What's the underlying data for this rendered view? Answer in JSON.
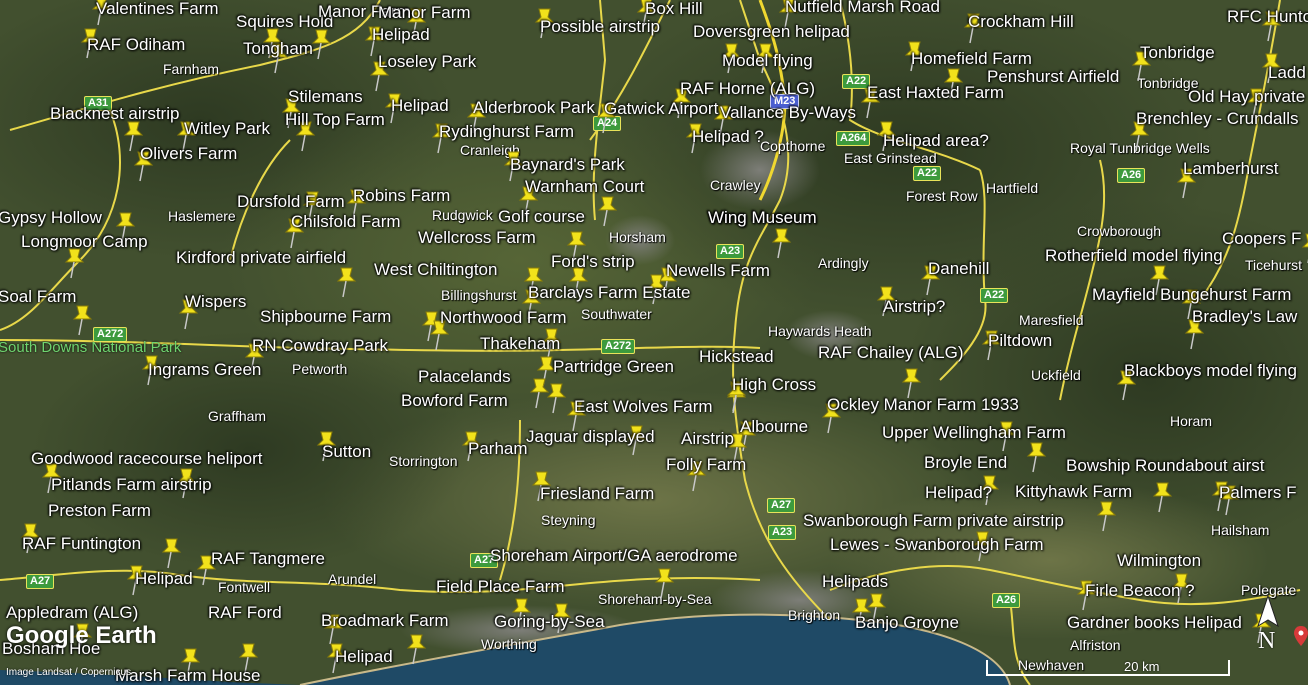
{
  "map": {
    "logo": "Google Earth",
    "attribution": "Image Landsat / Copernicus",
    "scale_label": "20 km",
    "compass_letter": "N",
    "park_label": "South Downs National Park",
    "placemarks": [
      "Valentines Farm",
      "Squires Hold",
      "Manor Farm",
      "Box Hill",
      "Nutfield Marsh Road",
      "Crockham Hill",
      "RFC Hunto",
      "RAF Odiham",
      "Tongham",
      "Helipad",
      "Possible airstrip",
      "Doversgreen helipad",
      "Model flying",
      "Homefield Farm",
      "Tonbridge",
      "Loseley Park",
      "RAF Horne (ALG)",
      "Penshurst Airfield",
      "Ladd",
      "Stilemans",
      "Helipad",
      "Alderbrook Park",
      "Gatwick Airport",
      "Vallance By-Ways",
      "East Haxted Farm",
      "Old Hay private",
      "Blacknest airstrip",
      "Witley Park",
      "Hill Top Farm",
      "Rydinghurst Farm",
      "Helipad ?",
      "Helipad area?",
      "Brenchley - Crundalls",
      "Olivers Farm",
      "Baynard's Park",
      "Lamberhurst",
      "Warnham Court",
      "Dursfold Farm",
      "Robins Farm",
      "Gypsy Hollow",
      "Golf course",
      "Chilsfold Farm",
      "Wing Museum",
      "Longmoor Camp",
      "Wellcross Farm",
      "Coopers F",
      "Kirdford private airfield",
      "Ford's strip",
      "Rotherfield model flying",
      "West Chiltington",
      "Newells Farm",
      "Danehill",
      "Soal Farm",
      "Barclays Farm Estate",
      "Mayfield Bungehurst Farm",
      "Wispers",
      "Airstrip?",
      "Shipbourne Farm",
      "Northwood Farm",
      "Bradley's Law",
      "RN Cowdray Park",
      "Thakeham",
      "Hickstead",
      "RAF Chailey (ALG)",
      "Piltdown",
      "Ingrams Green",
      "Partridge Green",
      "Blackboys model flying",
      "Palacelands",
      "High Cross",
      "Bowford Farm",
      "East Wolves Farm",
      "Ockley Manor Farm 1933",
      "Albourne",
      "Upper Wellingham Farm",
      "Sutton",
      "Jaguar displayed",
      "Airstrip",
      "Parham",
      "Broyle End",
      "Bowship Roundabout airst",
      "Goodwood racecourse heliport",
      "Folly Farm",
      "Pitlands Farm airstrip",
      "Helipad?",
      "Kittyhawk Farm",
      "Palmers F",
      "Friesland Farm",
      "Preston Farm",
      "Swanborough Farm private airstrip",
      "RAF Funtington",
      "Lewes - Swanborough Farm",
      "Shoreham Airport/GA aerodrome",
      "RAF Tangmere",
      "Wilmington",
      "Helipad",
      "Helipads",
      "Field Place Farm",
      "Firle Beacon ?",
      "Appledram (ALG)",
      "RAF Ford",
      "Broadmark Farm",
      "Goring-by-Sea",
      "Banjo Groyne",
      "Gardner books Helipad",
      "Bosham Hoe",
      "Helipad",
      "Marsh Farm House",
      "Manor Farm",
      "Wing Museum"
    ],
    "towns": [
      "Farnham",
      "Tonbridge",
      "Copthorne",
      "East Grinstead",
      "Royal Tunbridge Wells",
      "Crawley",
      "Forest Row",
      "Hartfield",
      "Cranleigh",
      "Haslemere",
      "Rudgwick",
      "Horsham",
      "Crowborough",
      "Ticehurst",
      "Billingshurst",
      "Southwater",
      "Ardingly",
      "Maresfield",
      "Haywards Heath",
      "Petworth",
      "Uckfield",
      "Graffham",
      "Horam",
      "Storrington",
      "Steyning",
      "Hailsham",
      "Fontwell",
      "Arundel",
      "Shoreham-by-Sea",
      "Worthing",
      "Brighton",
      "Polegate",
      "Newhaven",
      "Alfriston"
    ],
    "roads": [
      "A31",
      "A24",
      "A22",
      "A264",
      "A22",
      "A26",
      "A272",
      "A272",
      "A23",
      "A22",
      "A27",
      "A23",
      "A27",
      "A26",
      "A27",
      "M23"
    ]
  }
}
